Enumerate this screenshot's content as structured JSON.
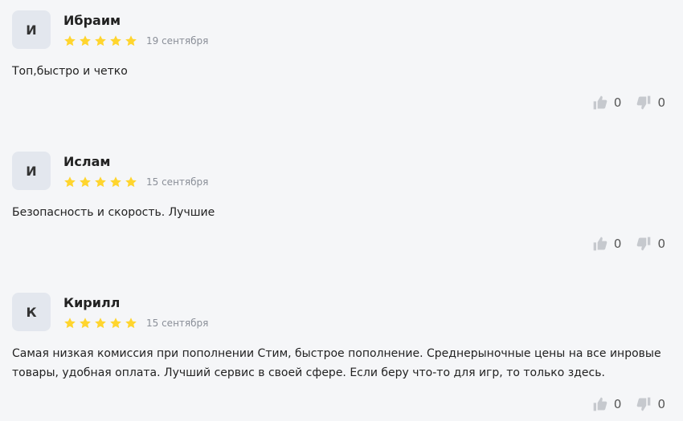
{
  "reviews": [
    {
      "initial": "И",
      "name": "Ибраим",
      "rating": 5,
      "date": "19 сентября",
      "text": "Топ,быстро и четко",
      "likes": "0",
      "dislikes": "0"
    },
    {
      "initial": "И",
      "name": "Ислам",
      "rating": 5,
      "date": "15 сентября",
      "text": "Безопасность и скорость. Лучшие",
      "likes": "0",
      "dislikes": "0"
    },
    {
      "initial": "К",
      "name": "Кирилл",
      "rating": 5,
      "date": "15 сентября",
      "text": "Самая низкая комиссия при пополнении Стим, быстрое пополнение. Среднерыночные цены на все инровые товары, удобная оплата. Лучший сервис в своей сфере. Если беру что-то для игр, то только здесь.",
      "likes": "0",
      "dislikes": "0"
    }
  ],
  "colors": {
    "star": "#ffd52e",
    "avatar_bg": "#e3e7ee",
    "thumb": "#c6c9ce",
    "background": "#f5f6f8"
  },
  "icons": {
    "star": "star-icon",
    "like": "thumbs-up-icon",
    "dislike": "thumbs-down-icon"
  }
}
